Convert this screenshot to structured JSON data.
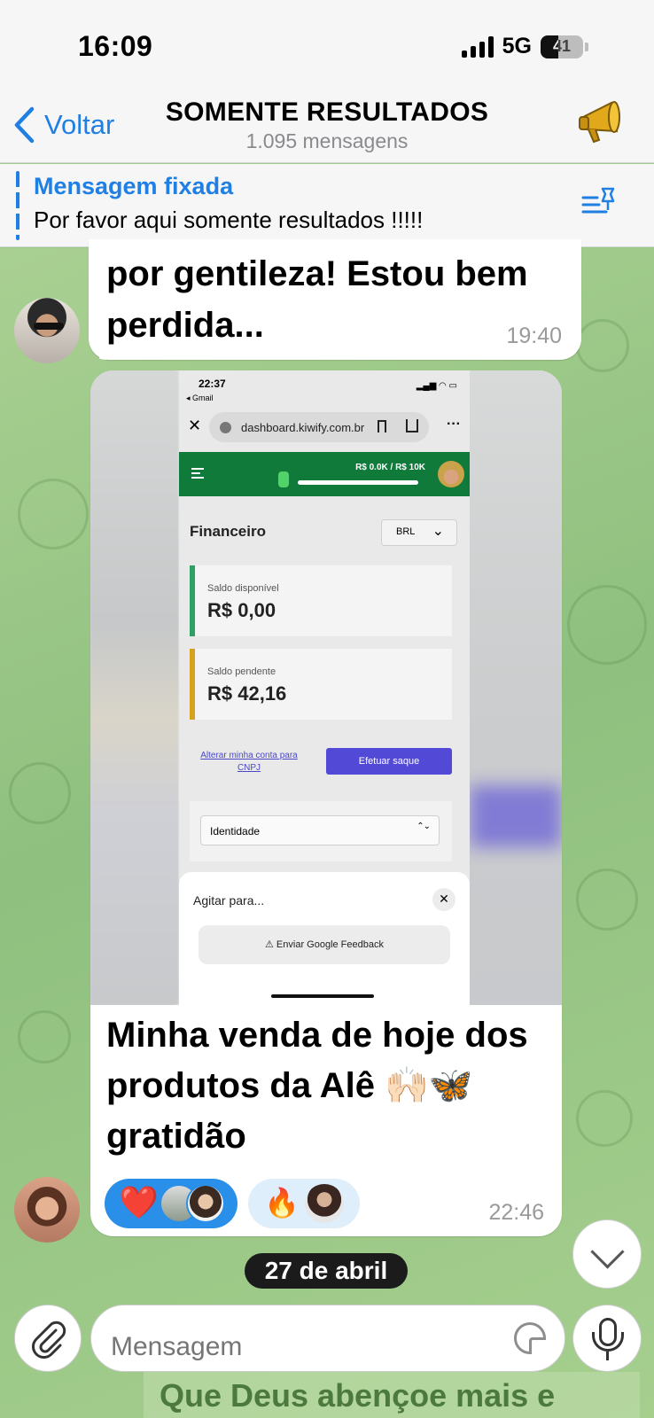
{
  "status": {
    "time": "16:09",
    "network": "5G",
    "battery": "41",
    "battery_fill": 0.41
  },
  "header": {
    "back_label": "Voltar",
    "title": "SOMENTE RESULTADOS",
    "subtitle": "1.095 mensagens",
    "icon": "megaphone-icon"
  },
  "pinned": {
    "title": "Mensagem fixada",
    "text": "Por favor aqui somente resultados !!!!!"
  },
  "messages": [
    {
      "text": "por gentileza! Estou bem perdida...",
      "time": "19:40"
    },
    {
      "caption": "Minha venda de hoje dos produtos da Alê 🙌🏻🦋 gratidão",
      "time": "22:46",
      "reactions": [
        {
          "emoji": "❤️"
        },
        {
          "emoji": "🔥"
        }
      ],
      "screenshot": {
        "time": "22:37",
        "back_app": "◂ Gmail",
        "url": "dashboard.kiwify.com.br",
        "goal": "R$ 0.0K / R$ 10K",
        "page_title": "Financeiro",
        "currency": "BRL",
        "cards": [
          {
            "label": "Saldo disponível",
            "value": "R$ 0,00"
          },
          {
            "label": "Saldo pendente",
            "value": "R$ 42,16"
          }
        ],
        "link": "Alterar minha conta para CNPJ",
        "button": "Efetuar saque",
        "select": "Identidade",
        "sheet_title": "Agitar para...",
        "sheet_action": "Enviar Google Feedback"
      }
    }
  ],
  "date_divider": "27 de abril",
  "composer": {
    "placeholder": "Mensagem"
  },
  "behind_text": "Que Deus abençoe mais e"
}
